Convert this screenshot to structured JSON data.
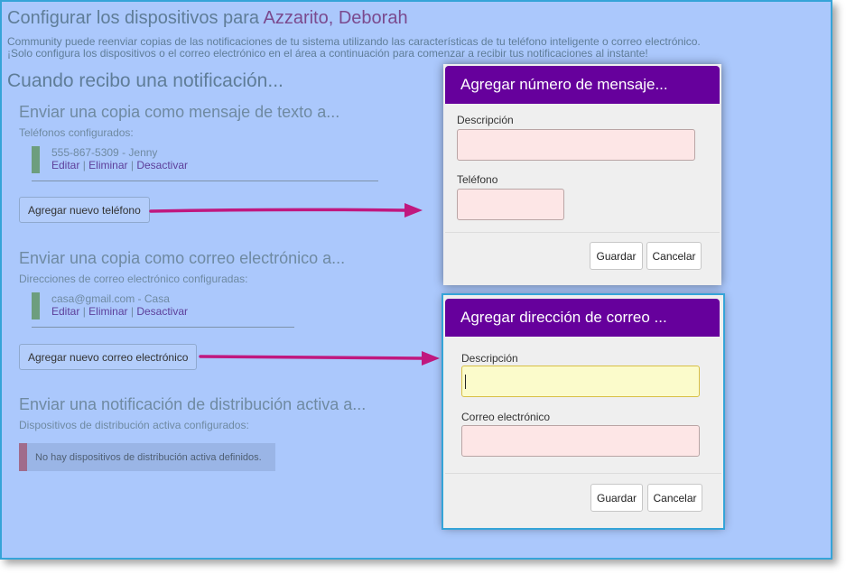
{
  "page": {
    "title_prefix": "Configurar los dispositivos para ",
    "user_name": "Azzarito, Deborah",
    "intro_line1": "Community puede reenviar copias de las notificaciones de tu sistema utilizando las características de tu teléfono inteligente o correo electrónico.",
    "intro_line2": "¡Solo configura los dispositivos o el correo electrónico en el área a continuación para comenzar a recibir tus notificaciones al instante!",
    "main_heading": "Cuando recibo una notificación..."
  },
  "sms": {
    "heading": "Enviar una copia como mensaje de texto a...",
    "subheading": "Teléfonos configurados:",
    "entry": "555-867-5309 - Jenny",
    "edit": "Editar",
    "delete": "Eliminar",
    "disable": "Desactivar",
    "sep": "|",
    "add_button": "Agregar nuevo teléfono"
  },
  "email": {
    "heading": "Enviar una copia como correo electrónico a...",
    "subheading": "Direcciones de correo electrónico configuradas:",
    "entry": "casa@gmail.com - Casa",
    "edit": "Editar",
    "delete": "Eliminar",
    "disable": "Desactivar",
    "sep": "|",
    "add_button": "Agregar nuevo correo electrónico"
  },
  "push": {
    "heading": "Enviar una notificación de distribución activa a...",
    "subheading": "Dispositivos de distribución activa configurados:",
    "empty": "No hay dispositivos de distribución activa definidos."
  },
  "phone_modal": {
    "title": "Agregar número de mensaje...",
    "description_label": "Descripción",
    "description_value": "",
    "phone_label": "Teléfono",
    "phone_value": "",
    "save": "Guardar",
    "cancel": "Cancelar"
  },
  "email_modal": {
    "title": "Agregar dirección de correo ...",
    "description_label": "Descripción",
    "description_value": "",
    "email_label": "Correo electrónico",
    "email_value": "",
    "save": "Guardar",
    "cancel": "Cancelar"
  },
  "colors": {
    "background": "#abc8fc",
    "modal_header": "#66009c",
    "arrow": "#c0187f",
    "input_error": "#fde6e6",
    "input_focus": "#fbfbcb"
  }
}
